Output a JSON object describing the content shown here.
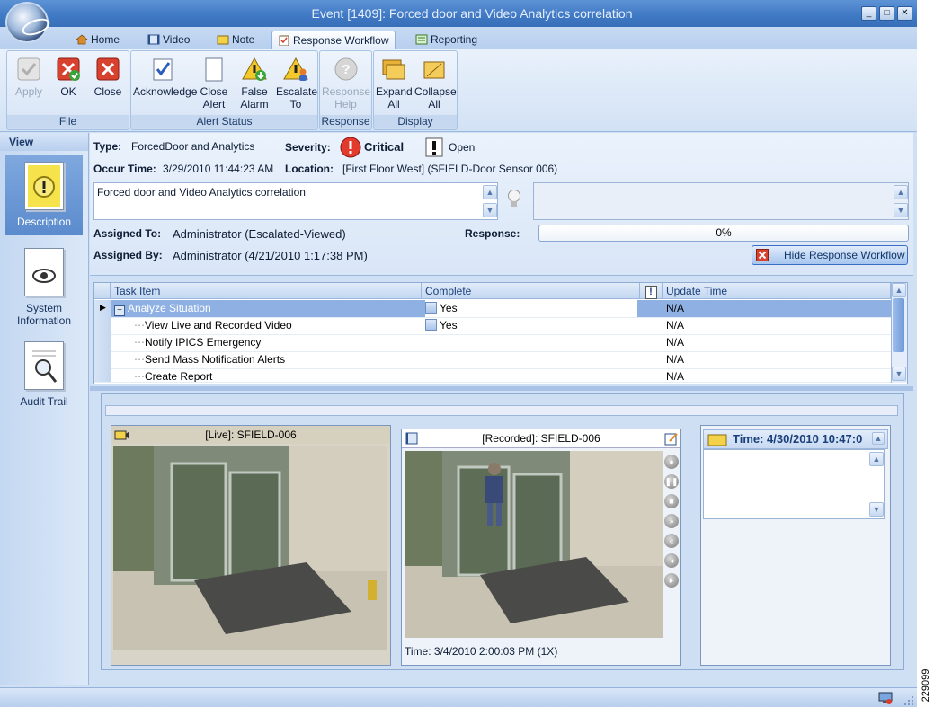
{
  "window": {
    "title": "Event [1409]: Forced door and Video Analytics correlation",
    "controls": {
      "minimize": "_",
      "maximize": "□",
      "close": "✕"
    }
  },
  "tabs": [
    {
      "label": "Home",
      "icon": "home-icon"
    },
    {
      "label": "Video",
      "icon": "video-icon"
    },
    {
      "label": "Note",
      "icon": "note-icon"
    },
    {
      "label": "Response Workflow",
      "icon": "clipboard-icon",
      "active": true
    },
    {
      "label": "Reporting",
      "icon": "report-icon"
    }
  ],
  "ribbon": {
    "groups": [
      {
        "label": "File",
        "buttons": [
          {
            "label": "Apply",
            "icon": "check-icon",
            "disabled": true
          },
          {
            "label": "OK",
            "icon": "ok-icon"
          },
          {
            "label": "Close",
            "icon": "close-x-icon"
          }
        ]
      },
      {
        "label": "Alert Status",
        "buttons": [
          {
            "label": "Acknowledge",
            "icon": "acknowledge-icon"
          },
          {
            "label": "Close Alert",
            "icon": "blank-page-icon"
          },
          {
            "label": "False Alarm",
            "icon": "warning-down-icon"
          },
          {
            "label": "Escalate To",
            "icon": "warning-person-icon"
          }
        ]
      },
      {
        "label": "Response",
        "buttons": [
          {
            "label": "Response Help",
            "icon": "help-icon",
            "disabled": true
          }
        ]
      },
      {
        "label": "Display",
        "buttons": [
          {
            "label": "Expand All",
            "icon": "folders-icon"
          },
          {
            "label": "Collapse All",
            "icon": "folder-icon"
          }
        ]
      }
    ]
  },
  "view": {
    "header": "View",
    "items": [
      {
        "label": "Description",
        "icon": "alert-document-icon",
        "selected": true
      },
      {
        "label": "System Information",
        "icon": "eye-document-icon"
      },
      {
        "label": "Audit Trail",
        "icon": "search-document-icon"
      }
    ]
  },
  "details": {
    "type_label": "Type:",
    "type_value": "ForcedDoor and Analytics",
    "severity_label": "Severity:",
    "severity_value": "Critical",
    "status_value": "Open",
    "occur_label": "Occur Time:",
    "occur_value": "3/29/2010 11:44:23 AM",
    "location_label": "Location:",
    "location_value": "[First Floor West] (SFIELD-Door Sensor 006)",
    "description": "Forced door and Video Analytics correlation",
    "assigned_to_label": "Assigned To:",
    "assigned_to_value": "Administrator (Escalated-Viewed)",
    "assigned_by_label": "Assigned By:",
    "assigned_by_value": "Administrator (4/21/2010 1:17:38 PM)",
    "response_label": "Response:",
    "response_progress": "0%",
    "hide_button": "Hide Response Workflow"
  },
  "tasks": {
    "columns": [
      "Task Item",
      "Complete",
      "!",
      "Update Time"
    ],
    "rows": [
      {
        "item": "Analyze Situation",
        "complete": "Yes",
        "update": "N/A",
        "selected": true,
        "level": 0
      },
      {
        "item": "View Live and Recorded Video",
        "complete": "Yes",
        "update": "N/A",
        "level": 1
      },
      {
        "item": "Notify IPICS Emergency",
        "complete": "",
        "update": "N/A",
        "level": 1
      },
      {
        "item": "Send Mass Notification Alerts",
        "complete": "",
        "update": "N/A",
        "level": 1
      },
      {
        "item": "Create Report",
        "complete": "",
        "update": "N/A",
        "level": 1
      }
    ]
  },
  "video": {
    "live_title": "[Live]: SFIELD-006",
    "recorded_title": "[Recorded]: SFIELD-006",
    "recorded_time": "Time: 3/4/2010 2:00:03 PM (1X)",
    "note_time": "Time: 4/30/2010 10:47:0"
  },
  "footer": {
    "code": "229099"
  }
}
